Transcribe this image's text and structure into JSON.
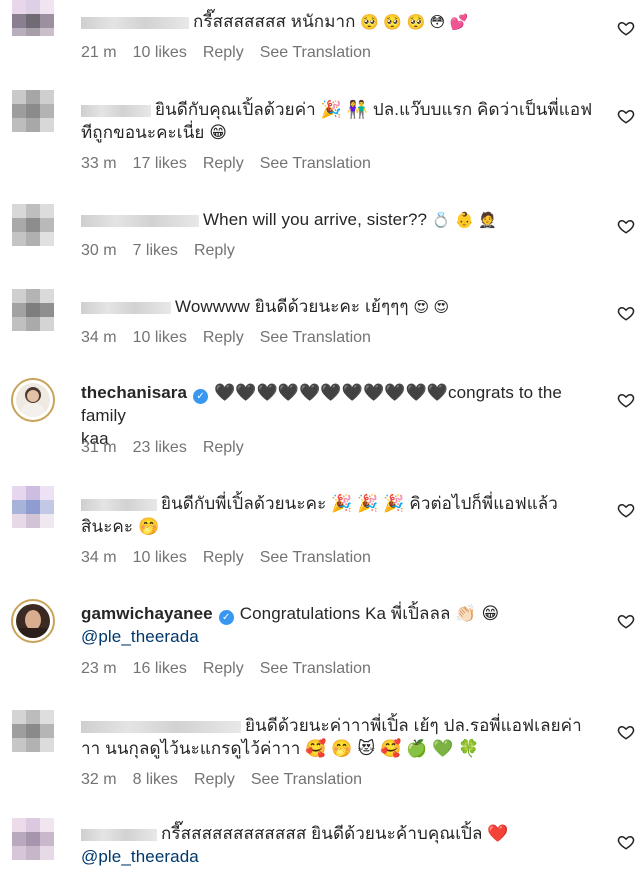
{
  "comments": [
    {
      "username": "",
      "text": "กรี๊สสสสสสส หนักมาก",
      "emoji": "🥺 🥺 🥺 😳 💕",
      "time": "21 m",
      "likes": "10 likes",
      "reply": "Reply",
      "translate": "See Translation"
    },
    {
      "username": "",
      "text": "ยินดีกับคุณเปิ้ลด้วยค่า 🎉 👫 ปล.แว๊บบแรก คิดว่าเป็นพี่แอฟ",
      "text2": "ทีถูกขอนะคะเนี่ย 😁",
      "time": "33 m",
      "likes": "17 likes",
      "reply": "Reply",
      "translate": "See Translation"
    },
    {
      "username": "",
      "text": "When will you arrive, sister??",
      "emoji": "💍 👶 🤵",
      "time": "30 m",
      "likes": "7 likes",
      "reply": "Reply"
    },
    {
      "username": "",
      "text": "Wowwww ยินดีด้วยนะคะ เย้ๆๆๆ",
      "emoji": "😍 😍",
      "time": "34 m",
      "likes": "10 likes",
      "reply": "Reply",
      "translate": "See Translation"
    },
    {
      "username": "thechanisara",
      "text": "🖤🖤🖤🖤🖤🖤🖤🖤🖤🖤🖤congrats to the family",
      "text2": "kaa",
      "time": "31 m",
      "likes": "23 likes",
      "reply": "Reply"
    },
    {
      "username": "",
      "text": "ยินดีกับพี่เปิ้ลด้วยนะคะ 🎉 🎉 🎉 คิวต่อไปก็พี่แอฟแล้ว",
      "text2": "สินะคะ 🤭",
      "time": "34 m",
      "likes": "10 likes",
      "reply": "Reply",
      "translate": "See Translation"
    },
    {
      "username": "gamwichayanee",
      "text": "Congratulations Ka พี่เปิ้ลลล 👏🏻 😁",
      "text2": "@ple_theerada",
      "time": "23 m",
      "likes": "16 likes",
      "reply": "Reply",
      "translate": "See Translation"
    },
    {
      "username": "",
      "text": "ยินดีด้วยนะค่าาาพี่เปิ้ล เย้ๆ ปล.รอพี่แอฟเลยค่า",
      "text2": "าา นนกุลดูไว้นะแกรดูไว้ค่าาา 🥰 🤭 😻 🥰 🍏 💚 🍀",
      "time": "32 m",
      "likes": "8 likes",
      "reply": "Reply",
      "translate": "See Translation"
    },
    {
      "username": "",
      "text": "กรี๊สสสสสสสสสสสส ยินดีด้วยนะค้าบคุณเปิ้ล ❤️",
      "text2": "@ple_theerada"
    }
  ]
}
